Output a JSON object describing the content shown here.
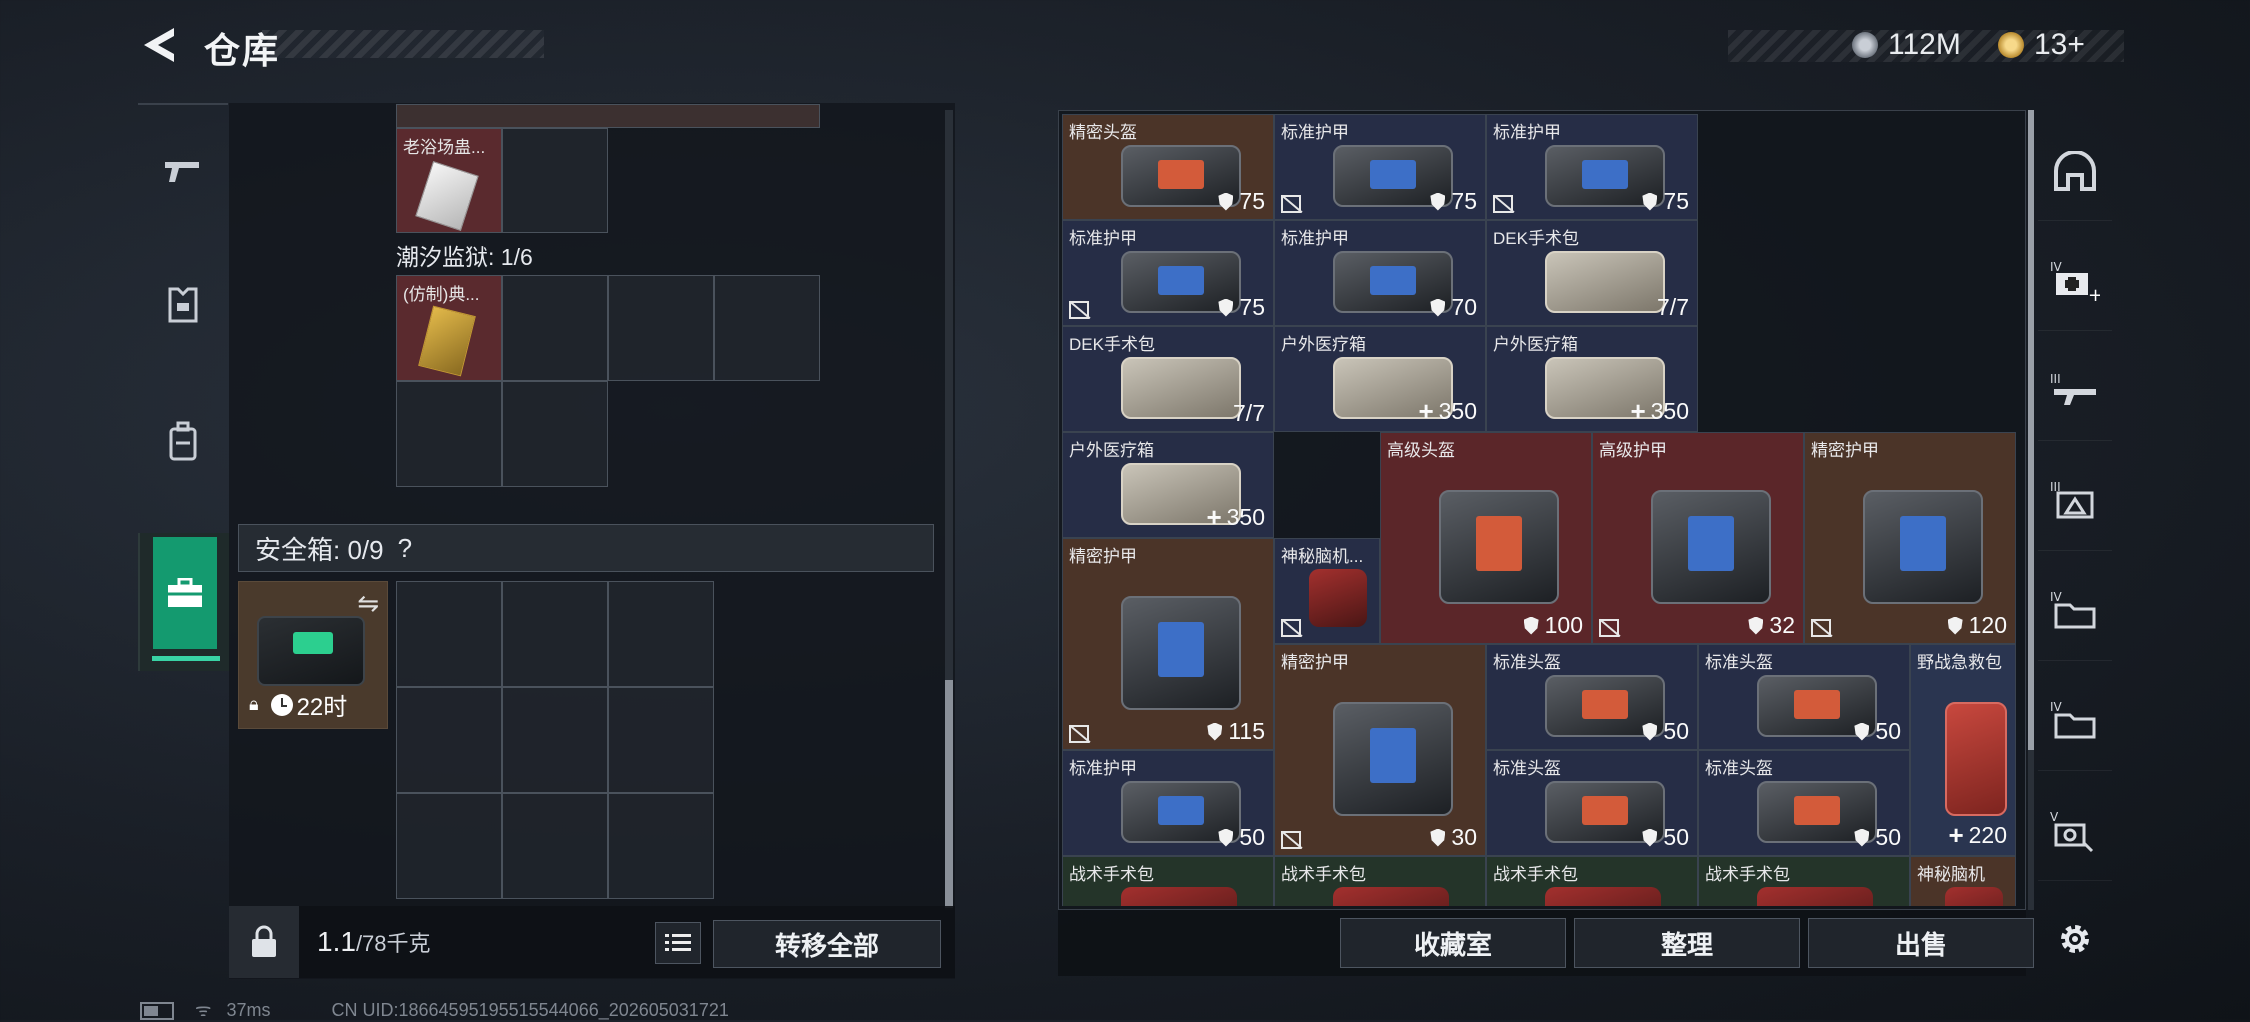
{
  "header": {
    "title": "仓库",
    "currency_1": "112M",
    "currency_2": "13+"
  },
  "left_nav": {
    "items": [
      "weapon-icon",
      "armor-vest-icon",
      "backpack-icon",
      "briefcase-icon"
    ],
    "active": 3
  },
  "stash": {
    "top_item_label": "老浴场蛊...",
    "section_label": "潮汐监狱: 1/6",
    "second_item_label": "(仿制)典...",
    "safebox_label": "安全箱: 0/9",
    "safebox_help": "?",
    "safebox_timer": "22时",
    "weight_value": "1.1",
    "weight_cap": "/78千克",
    "transfer_all": "转移全部"
  },
  "inventory": [
    {
      "name": "精密头盔",
      "value": "75",
      "kind": "shield",
      "color": "brown",
      "no_icon": false
    },
    {
      "name": "标准护甲",
      "value": "75",
      "kind": "shield",
      "color": "blue",
      "no_icon": true
    },
    {
      "name": "标准护甲",
      "value": "75",
      "kind": "shield",
      "color": "blue",
      "no_icon": true
    },
    {
      "name": "标准护甲",
      "value": "75",
      "kind": "shield",
      "color": "blue",
      "no_icon": true
    },
    {
      "name": "标准护甲",
      "value": "70",
      "kind": "shield",
      "color": "blue",
      "no_icon": false
    },
    {
      "name": "DEK手术包",
      "value": "7/7",
      "kind": "count",
      "color": "blue",
      "no_icon": false
    },
    {
      "name": "DEK手术包",
      "value": "7/7",
      "kind": "count",
      "color": "blue",
      "no_icon": false
    },
    {
      "name": "户外医疗箱",
      "value": "350",
      "kind": "plus",
      "color": "blue",
      "no_icon": false
    },
    {
      "name": "户外医疗箱",
      "value": "350",
      "kind": "plus",
      "color": "blue",
      "no_icon": false
    },
    {
      "name": "户外医疗箱",
      "value": "350",
      "kind": "plus",
      "color": "blue",
      "no_icon": false
    },
    {
      "name": "高级头盔",
      "value": "100",
      "kind": "shield",
      "color": "red",
      "no_icon": false
    },
    {
      "name": "高级护甲",
      "value": "32",
      "kind": "shield",
      "color": "red",
      "no_icon": true
    },
    {
      "name": "精密护甲",
      "value": "120",
      "kind": "shield",
      "color": "brown",
      "no_icon": true
    },
    {
      "name": "精密护甲",
      "value": "115",
      "kind": "shield",
      "color": "brown",
      "no_icon": true
    },
    {
      "name": "神秘脑机...",
      "value": "",
      "kind": "none",
      "color": "blue",
      "no_icon": true
    },
    {
      "name": "精密护甲",
      "value": "30",
      "kind": "shield",
      "color": "brown",
      "no_icon": true
    },
    {
      "name": "标准头盔",
      "value": "50",
      "kind": "shield",
      "color": "blue",
      "no_icon": false
    },
    {
      "name": "标准头盔",
      "value": "50",
      "kind": "shield",
      "color": "blue",
      "no_icon": false
    },
    {
      "name": "野战急救包",
      "value": "220",
      "kind": "plus",
      "color": "dblue",
      "no_icon": false
    },
    {
      "name": "标准护甲",
      "value": "50",
      "kind": "shield",
      "color": "blue",
      "no_icon": false
    },
    {
      "name": "标准头盔",
      "value": "50",
      "kind": "shield",
      "color": "blue",
      "no_icon": false
    },
    {
      "name": "标准头盔",
      "value": "50",
      "kind": "shield",
      "color": "blue",
      "no_icon": false
    },
    {
      "name": "战术手术包",
      "value": "",
      "kind": "none",
      "color": "green",
      "no_icon": false
    },
    {
      "name": "战术手术包",
      "value": "",
      "kind": "none",
      "color": "green",
      "no_icon": false
    },
    {
      "name": "战术手术包",
      "value": "",
      "kind": "none",
      "color": "green",
      "no_icon": false
    },
    {
      "name": "战术手术包",
      "value": "",
      "kind": "none",
      "color": "green",
      "no_icon": false
    },
    {
      "name": "神秘脑机",
      "value": "",
      "kind": "none",
      "color": "brown",
      "no_icon": false
    }
  ],
  "actions": {
    "collection": "收藏室",
    "sort": "整理",
    "sell": "出售"
  },
  "status": {
    "ping": "37ms",
    "uid": "CN UID:18664595195515544066_202605031721"
  }
}
